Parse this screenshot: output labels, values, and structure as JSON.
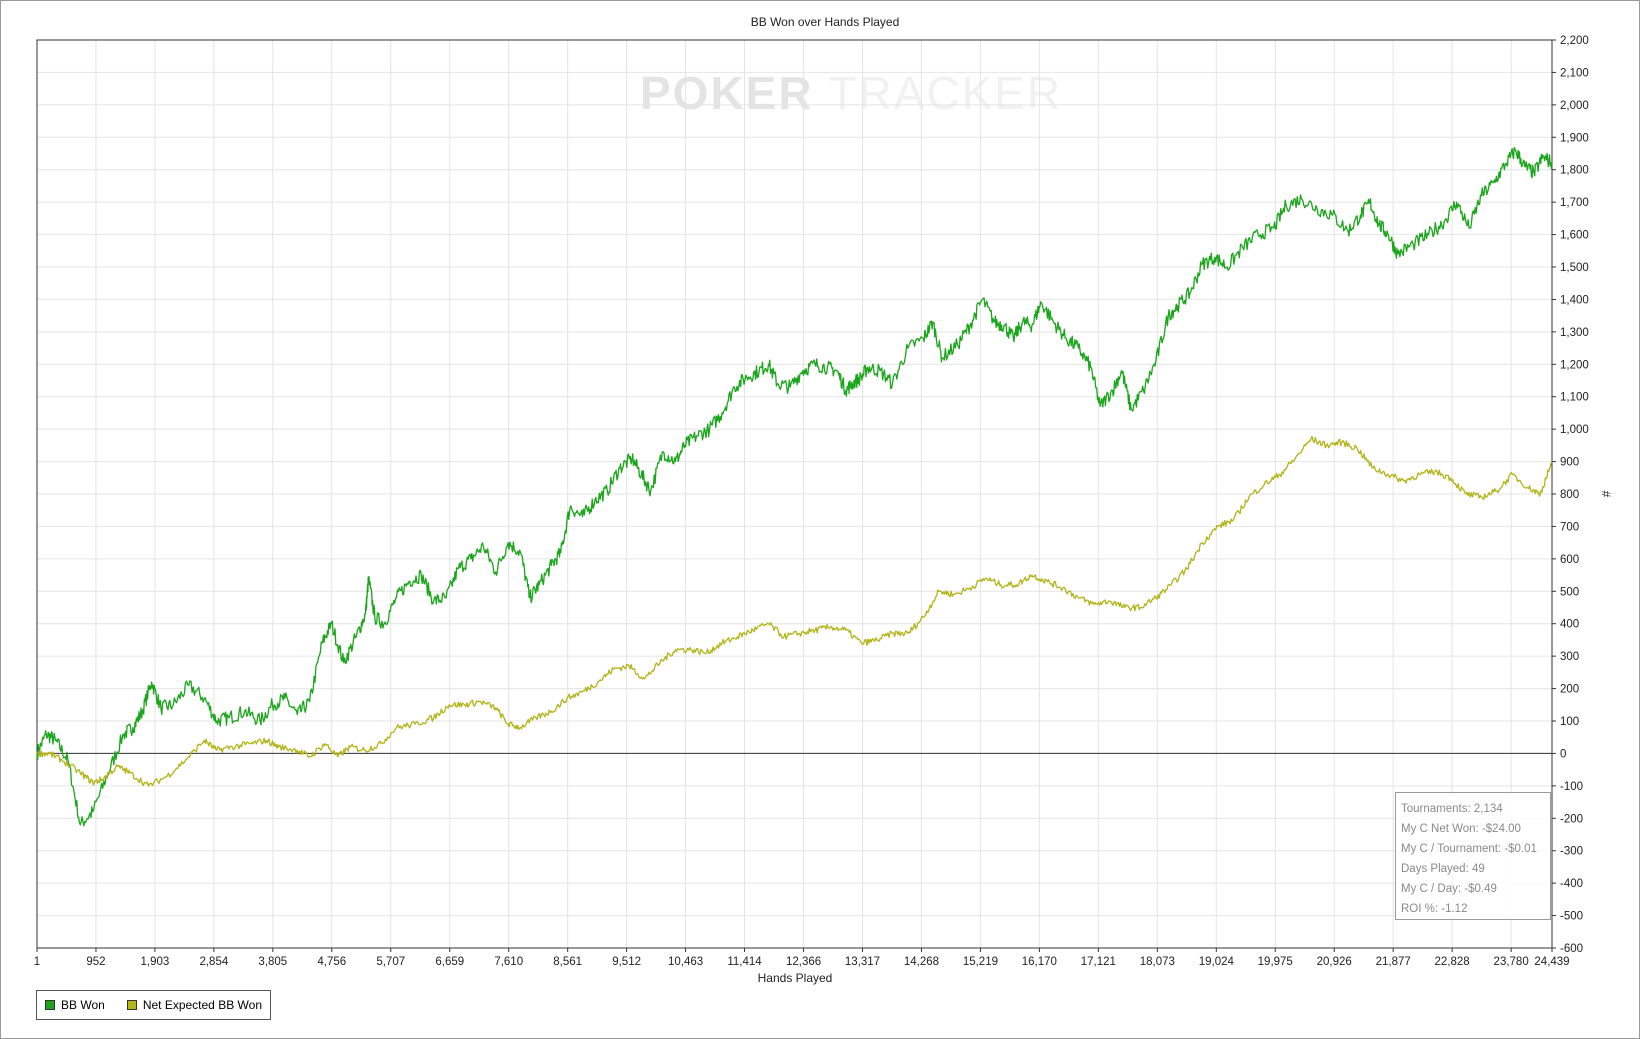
{
  "chart_data": {
    "type": "line",
    "title": "BB Won over Hands Played",
    "xlabel": "Hands Played",
    "ylabel": "#",
    "x_tick_labels": [
      "1",
      "952",
      "1,903",
      "2,854",
      "3,805",
      "4,756",
      "5,707",
      "6,659",
      "7,610",
      "8,561",
      "9,512",
      "10,463",
      "11,414",
      "12,366",
      "13,317",
      "14,268",
      "15,219",
      "16,170",
      "17,121",
      "18,073",
      "19,024",
      "19,975",
      "20,926",
      "21,877",
      "22,828",
      "23,780",
      "24,439"
    ],
    "xlim": [
      1,
      24439
    ],
    "ylim": [
      -600,
      2200
    ],
    "y_tick_step": 100,
    "y_axis_side": "right",
    "grid": true,
    "zero_line": true,
    "series": [
      {
        "name": "BB Won",
        "color": "#1aa51a",
        "points": [
          [
            1,
            0
          ],
          [
            150,
            60
          ],
          [
            300,
            40
          ],
          [
            500,
            -20
          ],
          [
            700,
            -220
          ],
          [
            900,
            -180
          ],
          [
            1150,
            -60
          ],
          [
            1400,
            60
          ],
          [
            1550,
            80
          ],
          [
            1700,
            130
          ],
          [
            1850,
            220
          ],
          [
            2000,
            140
          ],
          [
            2200,
            150
          ],
          [
            2450,
            210
          ],
          [
            2700,
            170
          ],
          [
            2900,
            100
          ],
          [
            3100,
            110
          ],
          [
            3350,
            130
          ],
          [
            3600,
            100
          ],
          [
            3800,
            150
          ],
          [
            4000,
            170
          ],
          [
            4200,
            120
          ],
          [
            4400,
            160
          ],
          [
            4600,
            340
          ],
          [
            4750,
            400
          ],
          [
            4950,
            280
          ],
          [
            5150,
            360
          ],
          [
            5300,
            430
          ],
          [
            5350,
            540
          ],
          [
            5450,
            420
          ],
          [
            5600,
            400
          ],
          [
            5800,
            480
          ],
          [
            6000,
            530
          ],
          [
            6200,
            550
          ],
          [
            6400,
            470
          ],
          [
            6600,
            480
          ],
          [
            6800,
            570
          ],
          [
            7000,
            600
          ],
          [
            7200,
            640
          ],
          [
            7400,
            560
          ],
          [
            7600,
            650
          ],
          [
            7800,
            620
          ],
          [
            7950,
            480
          ],
          [
            8100,
            520
          ],
          [
            8300,
            580
          ],
          [
            8450,
            620
          ],
          [
            8600,
            760
          ],
          [
            8800,
            730
          ],
          [
            9000,
            780
          ],
          [
            9200,
            810
          ],
          [
            9400,
            880
          ],
          [
            9600,
            910
          ],
          [
            9750,
            860
          ],
          [
            9900,
            810
          ],
          [
            10100,
            930
          ],
          [
            10300,
            900
          ],
          [
            10450,
            950
          ],
          [
            10650,
            980
          ],
          [
            10850,
            1000
          ],
          [
            11050,
            1050
          ],
          [
            11250,
            1130
          ],
          [
            11450,
            1160
          ],
          [
            11650,
            1180
          ],
          [
            11800,
            1200
          ],
          [
            11950,
            1140
          ],
          [
            12150,
            1130
          ],
          [
            12350,
            1180
          ],
          [
            12550,
            1200
          ],
          [
            12750,
            1190
          ],
          [
            12900,
            1180
          ],
          [
            13050,
            1120
          ],
          [
            13150,
            1140
          ],
          [
            13300,
            1160
          ],
          [
            13400,
            1190
          ],
          [
            13600,
            1180
          ],
          [
            13800,
            1140
          ],
          [
            14050,
            1250
          ],
          [
            14300,
            1280
          ],
          [
            14450,
            1330
          ],
          [
            14600,
            1220
          ],
          [
            14850,
            1260
          ],
          [
            15050,
            1320
          ],
          [
            15250,
            1400
          ],
          [
            15450,
            1330
          ],
          [
            15600,
            1320
          ],
          [
            15750,
            1280
          ],
          [
            15900,
            1330
          ],
          [
            16050,
            1320
          ],
          [
            16200,
            1390
          ],
          [
            16400,
            1330
          ],
          [
            16600,
            1280
          ],
          [
            16800,
            1250
          ],
          [
            17000,
            1190
          ],
          [
            17150,
            1070
          ],
          [
            17350,
            1120
          ],
          [
            17500,
            1180
          ],
          [
            17650,
            1060
          ],
          [
            17850,
            1120
          ],
          [
            18050,
            1210
          ],
          [
            18250,
            1350
          ],
          [
            18400,
            1380
          ],
          [
            18600,
            1420
          ],
          [
            18800,
            1510
          ],
          [
            19000,
            1530
          ],
          [
            19200,
            1500
          ],
          [
            19450,
            1560
          ],
          [
            19700,
            1600
          ],
          [
            19950,
            1620
          ],
          [
            20150,
            1690
          ],
          [
            20400,
            1710
          ],
          [
            20650,
            1680
          ],
          [
            20900,
            1660
          ],
          [
            21150,
            1610
          ],
          [
            21350,
            1660
          ],
          [
            21500,
            1700
          ],
          [
            21650,
            1630
          ],
          [
            21800,
            1600
          ],
          [
            21950,
            1540
          ],
          [
            22200,
            1570
          ],
          [
            22450,
            1600
          ],
          [
            22700,
            1640
          ],
          [
            22900,
            1700
          ],
          [
            23100,
            1620
          ],
          [
            23300,
            1720
          ],
          [
            23500,
            1760
          ],
          [
            23700,
            1820
          ],
          [
            23850,
            1860
          ],
          [
            24000,
            1810
          ],
          [
            24150,
            1790
          ],
          [
            24300,
            1840
          ],
          [
            24439,
            1820
          ]
        ]
      },
      {
        "name": "Net Expected BB Won",
        "color": "#b3b31a",
        "points": [
          [
            1,
            0
          ],
          [
            200,
            0
          ],
          [
            400,
            -20
          ],
          [
            700,
            -60
          ],
          [
            900,
            -90
          ],
          [
            1050,
            -80
          ],
          [
            1300,
            -40
          ],
          [
            1500,
            -60
          ],
          [
            1800,
            -100
          ],
          [
            2100,
            -70
          ],
          [
            2400,
            -20
          ],
          [
            2700,
            40
          ],
          [
            2900,
            10
          ],
          [
            3150,
            20
          ],
          [
            3450,
            30
          ],
          [
            3700,
            40
          ],
          [
            3900,
            20
          ],
          [
            4200,
            10
          ],
          [
            4400,
            -10
          ],
          [
            4650,
            30
          ],
          [
            4850,
            -10
          ],
          [
            5050,
            20
          ],
          [
            5300,
            10
          ],
          [
            5550,
            30
          ],
          [
            5800,
            80
          ],
          [
            6100,
            90
          ],
          [
            6400,
            110
          ],
          [
            6650,
            150
          ],
          [
            6900,
            150
          ],
          [
            7150,
            160
          ],
          [
            7400,
            140
          ],
          [
            7600,
            90
          ],
          [
            7800,
            80
          ],
          [
            8050,
            110
          ],
          [
            8300,
            130
          ],
          [
            8550,
            170
          ],
          [
            8800,
            190
          ],
          [
            9050,
            220
          ],
          [
            9300,
            260
          ],
          [
            9550,
            270
          ],
          [
            9800,
            230
          ],
          [
            10050,
            280
          ],
          [
            10300,
            320
          ],
          [
            10550,
            320
          ],
          [
            10800,
            310
          ],
          [
            11050,
            340
          ],
          [
            11300,
            360
          ],
          [
            11550,
            380
          ],
          [
            11800,
            400
          ],
          [
            12050,
            360
          ],
          [
            12300,
            370
          ],
          [
            12550,
            380
          ],
          [
            12800,
            390
          ],
          [
            13050,
            380
          ],
          [
            13300,
            340
          ],
          [
            13550,
            350
          ],
          [
            13800,
            370
          ],
          [
            14050,
            370
          ],
          [
            14300,
            420
          ],
          [
            14550,
            500
          ],
          [
            14800,
            490
          ],
          [
            15050,
            510
          ],
          [
            15300,
            540
          ],
          [
            15550,
            520
          ],
          [
            15800,
            520
          ],
          [
            16050,
            550
          ],
          [
            16300,
            530
          ],
          [
            16550,
            510
          ],
          [
            16800,
            480
          ],
          [
            17050,
            460
          ],
          [
            17300,
            470
          ],
          [
            17550,
            450
          ],
          [
            17800,
            450
          ],
          [
            18050,
            480
          ],
          [
            18300,
            520
          ],
          [
            18550,
            570
          ],
          [
            18800,
            650
          ],
          [
            19050,
            700
          ],
          [
            19300,
            720
          ],
          [
            19550,
            790
          ],
          [
            19800,
            830
          ],
          [
            20050,
            860
          ],
          [
            20300,
            910
          ],
          [
            20550,
            970
          ],
          [
            20800,
            950
          ],
          [
            21050,
            960
          ],
          [
            21300,
            940
          ],
          [
            21550,
            880
          ],
          [
            21800,
            860
          ],
          [
            22050,
            840
          ],
          [
            22300,
            860
          ],
          [
            22550,
            870
          ],
          [
            22800,
            850
          ],
          [
            23050,
            800
          ],
          [
            23300,
            790
          ],
          [
            23550,
            810
          ],
          [
            23800,
            860
          ],
          [
            24050,
            820
          ],
          [
            24250,
            800
          ],
          [
            24439,
            900
          ]
        ]
      }
    ]
  },
  "legend": [
    {
      "label": "BB Won",
      "color": "#1aa51a"
    },
    {
      "label": "Net Expected BB Won",
      "color": "#b3b31a"
    }
  ],
  "stats": [
    "Tournaments: 2,134",
    "My C Net Won: -$24.00",
    "My C / Tournament: -$0.01",
    "Days Played: 49",
    "My C / Day: -$0.49",
    "ROI %: -1.12"
  ],
  "watermark": {
    "logo_part1": "POKER",
    "logo_part2": "TRACKER"
  }
}
